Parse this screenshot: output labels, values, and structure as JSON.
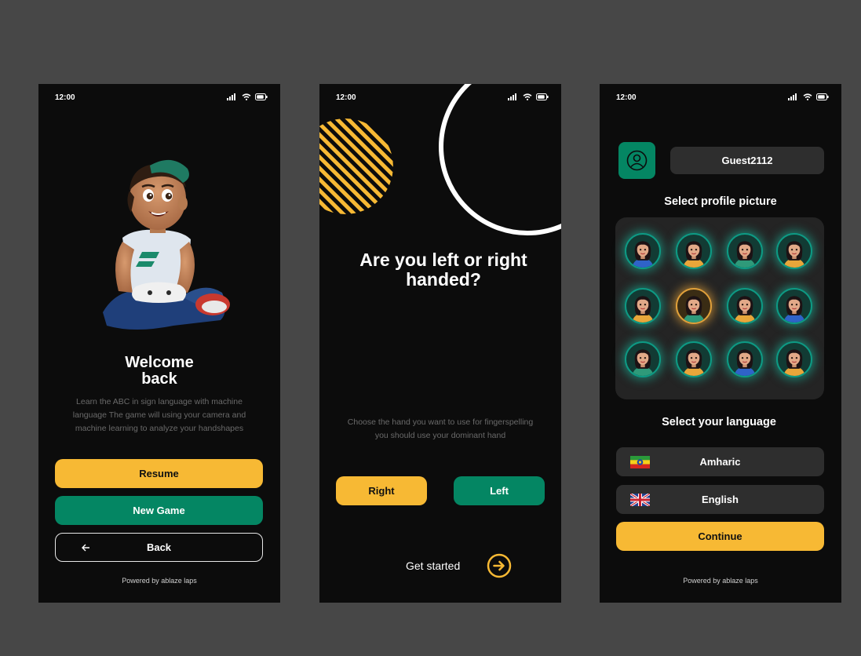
{
  "status": {
    "time": "12:00"
  },
  "screen1": {
    "title_line1": "Welcome",
    "title_line2": "back",
    "description": "Learn  the ABC in sign language with machine language The game will using your camera and machine learning to analyze your handshapes",
    "resume_label": "Resume",
    "new_game_label": "New Game",
    "back_label": "Back",
    "powered_by": "Powered by ablaze laps"
  },
  "screen2": {
    "question": "Are you left or right handed?",
    "description": "Choose the hand you want to use for fingerspelling you should use your dominant hand",
    "right_label": "Right",
    "left_label": "Left",
    "get_started_label": "Get started"
  },
  "screen3": {
    "username": "Guest2112",
    "select_picture_label": "Select profile picture",
    "avatar_count": 12,
    "selected_avatar_index": 5,
    "select_language_label": "Select your language",
    "languages": [
      {
        "label": "Amharic",
        "flag": "ethiopia-flag-icon"
      },
      {
        "label": "English",
        "flag": "uk-flag-icon"
      }
    ],
    "continue_label": "Continue",
    "powered_by": "Powered by ablaze laps"
  },
  "colors": {
    "background": "#474747",
    "screen": "#0c0c0c",
    "accent_yellow": "#f7b934",
    "accent_green": "#048663",
    "avatar_glow": "#15c4a8"
  }
}
